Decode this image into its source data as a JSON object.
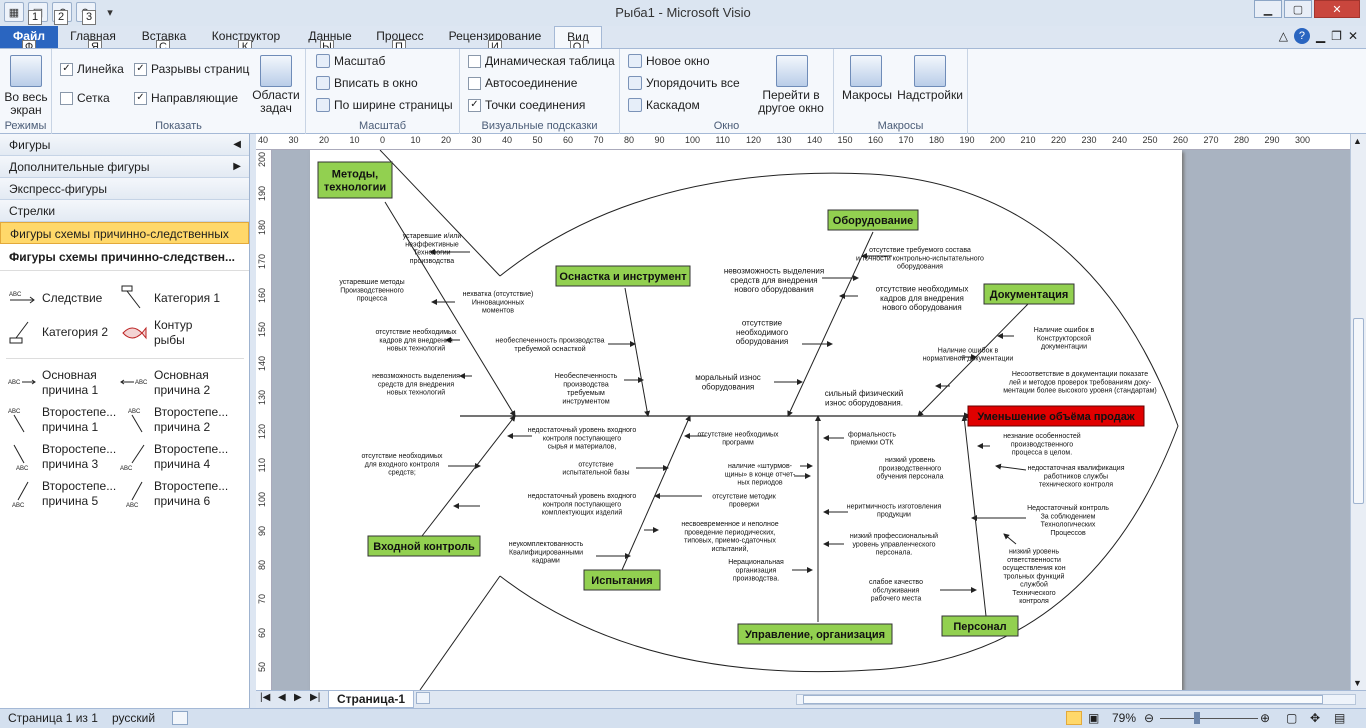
{
  "window": {
    "title": "Рыба1  -  Microsoft Visio"
  },
  "qat": {
    "keytips": [
      "1",
      "2",
      "3"
    ]
  },
  "tabs": [
    {
      "label": "Файл",
      "key": "Ф"
    },
    {
      "label": "Главная",
      "key": "Я"
    },
    {
      "label": "Вставка",
      "key": "С"
    },
    {
      "label": "Конструктор",
      "key": "К"
    },
    {
      "label": "Данные",
      "key": "Ы"
    },
    {
      "label": "Процесс",
      "key": "П"
    },
    {
      "label": "Рецензирование",
      "key": "И"
    },
    {
      "label": "Вид",
      "key": "О"
    }
  ],
  "ribbon": {
    "modes": {
      "btn": "Во весь\nэкран",
      "label": "Режимы"
    },
    "show": {
      "ruler": "Линейка",
      "grid": "Сетка",
      "breaks": "Разрывы страниц",
      "guides": "Направляющие",
      "taskpanes": "Области\nзадач",
      "label": "Показать"
    },
    "zoom": {
      "zoom": "Масштаб",
      "fit": "Вписать в окно",
      "width": "По ширине страницы",
      "label": "Масштаб"
    },
    "visual": {
      "dyn": "Динамическая таблица",
      "auto": "Автосоединение",
      "points": "Точки соединения",
      "label": "Визуальные подсказки"
    },
    "window": {
      "new": "Новое окно",
      "arrange": "Упорядочить все",
      "cascade": "Каскадом",
      "switch": "Перейти в\nдругое окно",
      "label": "Окно"
    },
    "macros": {
      "macros": "Макросы",
      "addins": "Надстройки",
      "label": "Макросы"
    }
  },
  "shapes": {
    "header": "Фигуры",
    "more": "Дополнительные фигуры",
    "quick": "Экспресс-фигуры",
    "arrows": "Стрелки",
    "fishbone": "Фигуры схемы причинно-следственных с...",
    "stencil_title": "Фигуры схемы причинно-следствен...",
    "items": [
      "Следствие",
      "Категория 1",
      "Категория 2",
      "Контур рыбы",
      "Основная причина 1",
      "Основная причина 2",
      "Второстепе... причина 1",
      "Второстепе... причина 2",
      "Второстепе... причина 3",
      "Второстепе... причина 4",
      "Второстепе... причина 5",
      "Второстепе... причина 6"
    ]
  },
  "ruler": {
    "top": [
      "40",
      "30",
      "20",
      "10",
      "0",
      "10",
      "20",
      "30",
      "40",
      "50",
      "60",
      "70",
      "80",
      "90",
      "100",
      "110",
      "120",
      "130",
      "140",
      "150",
      "160",
      "170",
      "180",
      "190",
      "200",
      "210",
      "220",
      "230",
      "240",
      "250",
      "260",
      "270",
      "280",
      "290",
      "300"
    ],
    "left": [
      "200",
      "190",
      "180",
      "170",
      "160",
      "150",
      "140",
      "130",
      "120",
      "110",
      "100",
      "90",
      "80",
      "70",
      "60",
      "50"
    ]
  },
  "diagram": {
    "effect": "Уменьшение объёма продаж",
    "categories": [
      "Методы,\nтехнологии",
      "Оснастка и инструмент",
      "Оборудование",
      "Документация",
      "Входной контроль",
      "Испытания",
      "Управление, организация",
      "Персонал"
    ],
    "causes": [
      "устаревшие и/или\nнеэффективные\nТехнологии\nпроизводства",
      "устаревшие методы\nПроизводственного\nпроцесса",
      "нехватка (отсутствие)\nИнновационных\nмоментов",
      "отсутствие необходимых\nкадров для внедрения\nновых технологий",
      "невозможность выделения\nсредств для внедрения\nновых технологий",
      "необеспеченность производства\nтребуемой оснасткой",
      "Необеспеченность\nпроизводства\nтребуемым\nинструментом",
      "невозможность выделения\nсредств для внедрения\nнового оборудования",
      "отсутствие\nнеобходимого\nоборудования",
      "моральный износ\nоборудования",
      "отсутствие требуемого состава\nи точности контрольно-испытательного\nоборудования",
      "отсутствие необходимых\nкадров для внедрения\nнового оборудования",
      "сильный физический\nизнос оборудования.",
      "Наличие ошибок в\nКонструкторской\nдокументации",
      "Наличие ошибок в\nнормативной документации",
      "Несоответствие в документации показате\nлей и методов проверок требованиям доку-\nментации более высокого уровня (стандартам)",
      "отсутствие необходимых\nдля входного контроля\nсредств;",
      "недостаточный уровень входного\nконтроля поступающего\nсырья и материалов,",
      "недостаточный уровень входного\nконтроля поступающего\nкомплектующих изделий",
      "отсутствие\nиспытательной базы",
      "отсутствие необходимых\nпрограмм",
      "наличие «штурмов-\nщины» в конце отчет-\nных периодов",
      "отсутствие методик\nпроверки",
      "несвоевременное и неполное\nпроведение периодических,\nтиповых, приемо-сдаточных\nиспытаний,",
      "неукомплектованность\nКвалифицированными\nкадрами",
      "формальность\nприемки ОТК",
      "низкий уровень\nпроизводственного\nобучения персонала",
      "неритмичность изготовления\nпродукции",
      "низкий профессиональный\nуровень управленческого\nперсонала.",
      "Нерациональная\nорганизация\nпроизводства.",
      "слабое качество\nобслуживания\nрабочего места",
      "незнание особенностей\nпроизводственного\nпроцесса в целом.",
      "недостаточная квалификация\nработников службы\nтехнического контроля",
      "Недостаточный контроль\nЗа соблюдением\nТехнологических\nПроцессов",
      "низкий уровень\nответственности\nосуществления кон\nтрольных функций\nслужбой\nТехнического\nконтроля"
    ]
  },
  "pagetab": "Страница-1",
  "status": {
    "page": "Страница 1 из 1",
    "lang": "русский",
    "zoom": "79%"
  }
}
